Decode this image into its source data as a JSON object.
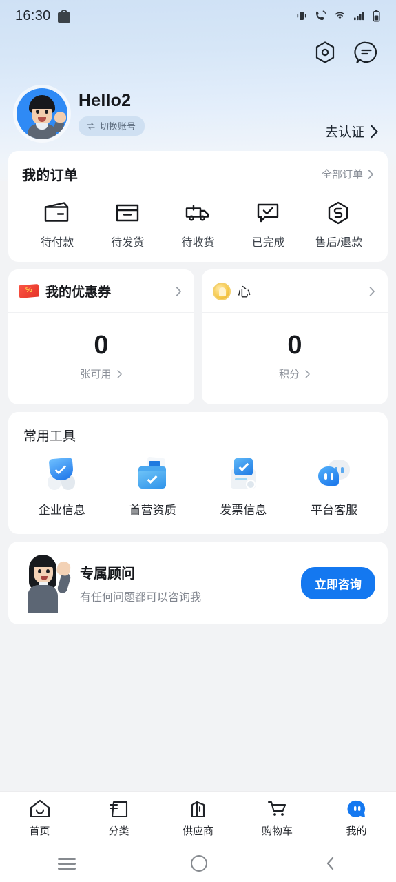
{
  "status_bar": {
    "time": "16:30",
    "left_icon": "shopping-bag-icon",
    "right_icons": [
      "vibrate-icon",
      "call-icon",
      "wifi-icon",
      "signal-icon",
      "battery-icon"
    ]
  },
  "header": {
    "settings_icon": "hexagon-settings-icon",
    "message_icon": "message-bubble-icon"
  },
  "profile": {
    "username": "Hello2",
    "switch_account_label": "切换账号",
    "verify_label": "去认证",
    "avatar_alt": "user-avatar"
  },
  "orders": {
    "title": "我的订单",
    "more_label": "全部订单",
    "items": [
      {
        "label": "待付款",
        "icon": "wallet-icon"
      },
      {
        "label": "待发货",
        "icon": "box-icon"
      },
      {
        "label": "待收货",
        "icon": "truck-icon"
      },
      {
        "label": "已完成",
        "icon": "check-bubble-icon"
      },
      {
        "label": "售后/退款",
        "icon": "refund-hexagon-icon"
      }
    ]
  },
  "coupon_card": {
    "title": "我的优惠券",
    "icon": "coupon-ticket-icon",
    "value": "0",
    "unit_label": "张可用"
  },
  "points_card": {
    "title": "心",
    "icon": "coin-icon",
    "value": "0",
    "unit_label": "积分"
  },
  "tools": {
    "title": "常用工具",
    "items": [
      {
        "label": "企业信息",
        "icon": "shield-check-icon"
      },
      {
        "label": "首营资质",
        "icon": "folder-check-icon"
      },
      {
        "label": "发票信息",
        "icon": "invoice-icon"
      },
      {
        "label": "平台客服",
        "icon": "customer-service-icon"
      }
    ]
  },
  "advisor": {
    "title": "专属顾问",
    "subtitle": "有任何问题都可以咨询我",
    "button_label": "立即咨询",
    "avatar_alt": "advisor-avatar"
  },
  "tabbar": {
    "items": [
      {
        "label": "首页",
        "icon": "home-icon",
        "active": false
      },
      {
        "label": "分类",
        "icon": "category-icon",
        "active": false
      },
      {
        "label": "供应商",
        "icon": "supplier-icon",
        "active": false
      },
      {
        "label": "购物车",
        "icon": "cart-icon",
        "active": false
      },
      {
        "label": "我的",
        "icon": "profile-icon",
        "active": true
      }
    ]
  },
  "android_nav": {
    "recents_icon": "recents-icon",
    "home_icon": "home-circle-icon",
    "back_icon": "back-chevron-icon"
  },
  "colors": {
    "accent": "#1478f0",
    "header_gradient_start": "#cfe1f5",
    "page_background": "#f2f3f5",
    "card_background": "#ffffff",
    "coupon_red": "#e43226",
    "coin_gold": "#f6c94b"
  }
}
